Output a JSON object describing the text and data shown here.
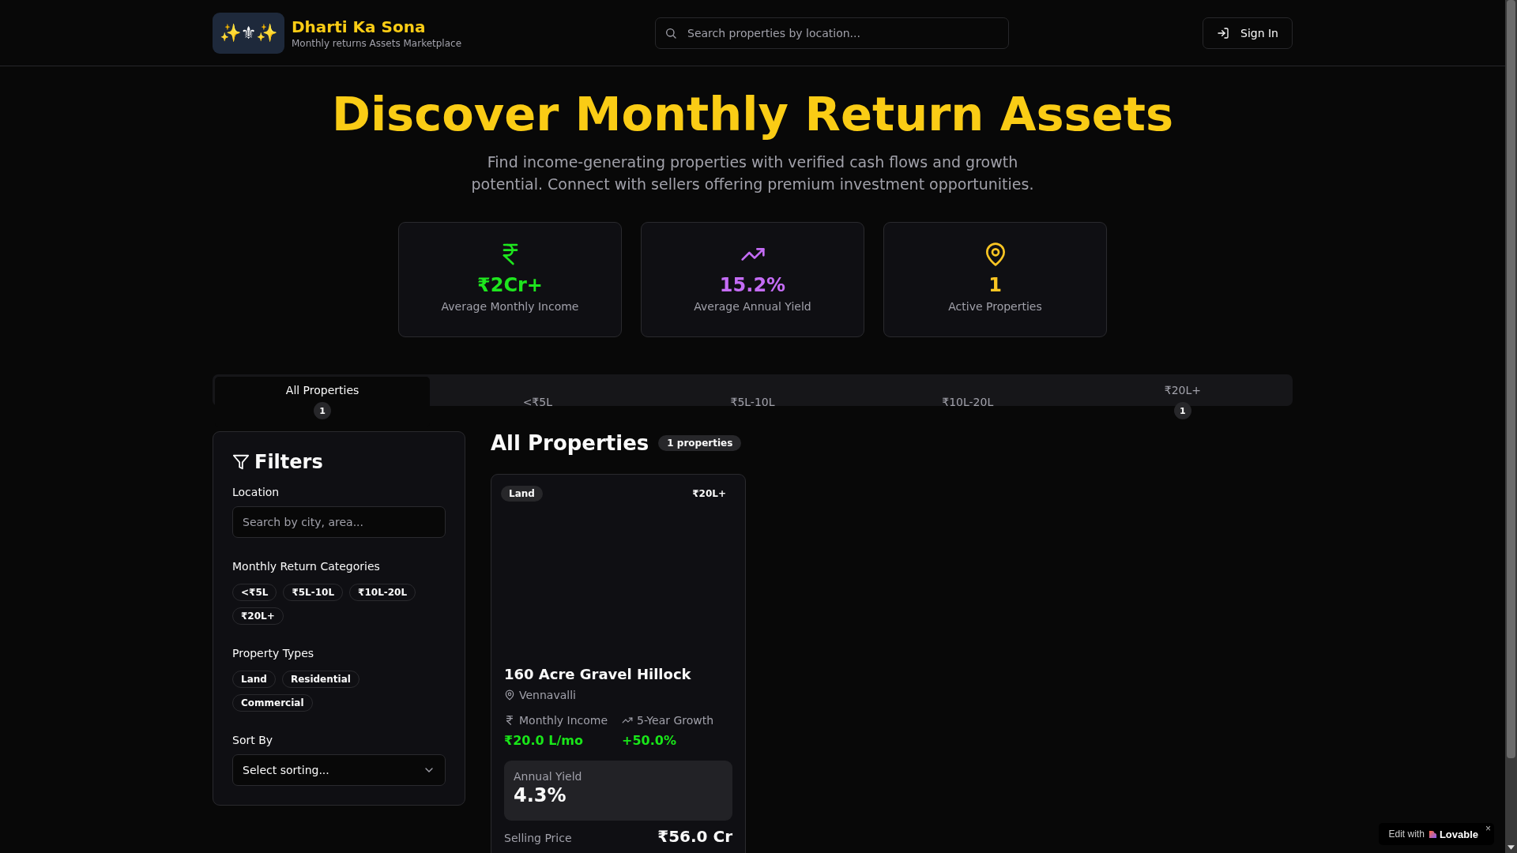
{
  "header": {
    "logo": "✨⚜✨",
    "brand": "Dharti Ka Sona",
    "tagline": "Monthly returns Assets Marketplace",
    "search_placeholder": "Search properties by location...",
    "sign_in": "Sign In"
  },
  "hero": {
    "title": "Discover Monthly Return Assets",
    "subtitle": "Find income-generating properties with verified cash flows and growth potential. Connect with sellers offering premium investment opportunities."
  },
  "stats": [
    {
      "kind": "income",
      "value": "₹2Cr+",
      "label": "Average Monthly Income",
      "color": "#1ee61e"
    },
    {
      "kind": "yield",
      "value": "15.2%",
      "label": "Average Annual Yield",
      "color": "#c46cf5"
    },
    {
      "kind": "location",
      "value": "1",
      "label": "Active Properties",
      "color": "#fac523"
    }
  ],
  "tabs": [
    {
      "label": "All Properties",
      "count": "1",
      "selected": true
    },
    {
      "label": "<₹5L",
      "selected": false
    },
    {
      "label": "₹5L-10L",
      "selected": false
    },
    {
      "label": "₹10L-20L",
      "selected": false
    },
    {
      "label": "₹20L+",
      "count": "1",
      "selected": false
    }
  ],
  "filters": {
    "title": "Filters",
    "location_label": "Location",
    "location_placeholder": "Search by city, area...",
    "categories_label": "Monthly Return Categories",
    "categories": [
      "<₹5L",
      "₹5L-10L",
      "₹10L-20L",
      "₹20L+"
    ],
    "types_label": "Property Types",
    "types": [
      "Land",
      "Residential",
      "Commercial"
    ],
    "sort_label": "Sort By",
    "sort_placeholder": "Select sorting..."
  },
  "listing": {
    "title": "All Properties",
    "count_badge": "1 properties",
    "properties": [
      {
        "type_tag": "Land",
        "category_tag": "₹20L+",
        "name": "160 Acre Gravel Hillock",
        "location": "Vennavalli",
        "income_label": "Monthly Income",
        "income_value": "₹20.0 L/mo",
        "growth_label": "5-Year Growth",
        "growth_value": "+50.0%",
        "yield_label": "Annual Yield",
        "yield_value": "4.3%",
        "price_label": "Selling Price",
        "price_value": "₹56.0 Cr"
      }
    ]
  },
  "edit_badge": {
    "prefix": "Edit with",
    "brand": "Lovable",
    "close": "×"
  }
}
